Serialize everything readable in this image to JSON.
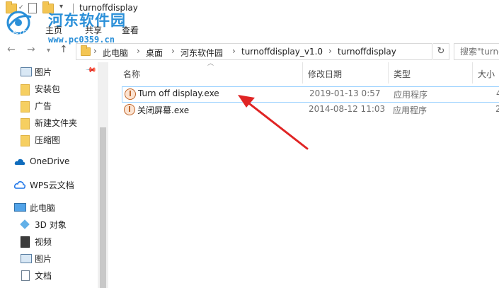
{
  "window": {
    "title": "turnoffdisplay"
  },
  "watermark": {
    "title": "河东软件园",
    "url": "www.pc0359.cn"
  },
  "ribbon": {
    "tabs": [
      "文件",
      "主页",
      "共享",
      "查看"
    ]
  },
  "address": {
    "crumbs": [
      "此电脑",
      "桌面",
      "河东软件园",
      "turnoffdisplay_v1.0",
      "turnoffdisplay"
    ],
    "search_placeholder": "搜索\"turnoffdisplay\""
  },
  "nav": {
    "quick_access": [
      {
        "label": "图片",
        "icon": "pictures-icon",
        "pinned": true
      },
      {
        "label": "安装包",
        "icon": "folder-icon"
      },
      {
        "label": "广告",
        "icon": "folder-icon"
      },
      {
        "label": "新建文件夹",
        "icon": "folder-icon"
      },
      {
        "label": "压缩图",
        "icon": "folder-icon"
      }
    ],
    "onedrive": "OneDrive",
    "wps": "WPS云文档",
    "this_pc": "此电脑",
    "pc_items": [
      {
        "label": "3D 对象",
        "icon": "3d-objects-icon"
      },
      {
        "label": "视频",
        "icon": "video-icon"
      },
      {
        "label": "图片",
        "icon": "pictures-icon"
      },
      {
        "label": "文档",
        "icon": "documents-icon"
      }
    ]
  },
  "columns": {
    "name": "名称",
    "date": "修改日期",
    "type": "类型",
    "size": "大小"
  },
  "files": [
    {
      "name": "Turn off display.exe",
      "date": "2019-01-13 0:57",
      "type": "应用程序",
      "size": "4",
      "selected": true
    },
    {
      "name": "关闭屏幕.exe",
      "date": "2014-08-12 11:03",
      "type": "应用程序",
      "size": "2",
      "selected": false
    }
  ],
  "colors": {
    "accent": "#0078d7",
    "arrow": "#e02424",
    "selection_border": "#99d1ff",
    "watermark": "#2a8fd8"
  }
}
